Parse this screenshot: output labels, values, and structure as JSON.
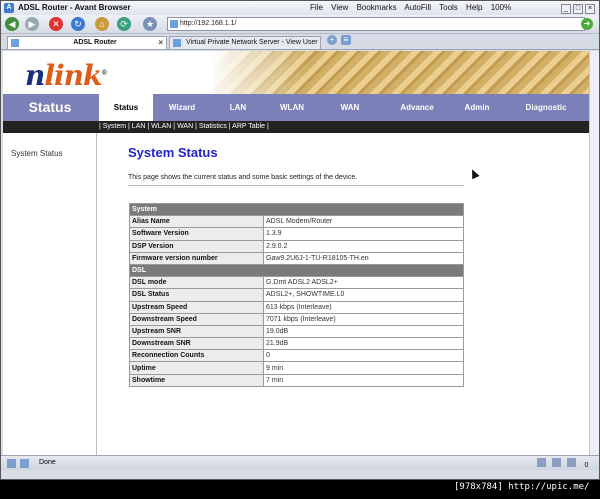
{
  "window": {
    "title": "ADSL Router - Avant Browser",
    "menu": [
      "File",
      "View",
      "Bookmarks",
      "AutoFill",
      "Tools",
      "Help",
      "100%"
    ]
  },
  "address": {
    "url": "http://192.168.1.1/"
  },
  "tabs": [
    {
      "label": "ADSL Router"
    },
    {
      "label": "Virtual Private Network Server - View User"
    }
  ],
  "router": {
    "logo_text_a": "n",
    "logo_text_b": "link",
    "section_label": "Status",
    "nav": [
      "Status",
      "Wizard",
      "LAN",
      "WLAN",
      "WAN",
      "Advance",
      "Admin",
      "Diagnostic"
    ],
    "subnav": "| System | LAN | WLAN | WAN | Statistics | ARP Table |",
    "side_item": "System Status"
  },
  "main": {
    "heading": "System Status",
    "description": "This page shows the current status and some basic settings of the device.",
    "system_header": "System",
    "system_rows": [
      {
        "key": "Alias Name",
        "value": "ADSL Modem/Router"
      },
      {
        "key": "Software Version",
        "value": "1.3.9"
      },
      {
        "key": "DSP Version",
        "value": "2.9.0.2"
      },
      {
        "key": "Firmware version number",
        "value": "Gaw9.2U6J-1-TU-R18105-TH.en"
      }
    ],
    "dsl_header": "DSL",
    "dsl_rows": [
      {
        "key": "DSL mode",
        "value": "G.Dmt ADSL2 ADSL2+"
      },
      {
        "key": "DSL Status",
        "value": "ADSL2+, SHOWTIME.L0"
      },
      {
        "key": "Upstream Speed",
        "value": "613 kbps  (Interleave)"
      },
      {
        "key": "Downstream Speed",
        "value": "7071 kbps  (Interleave)"
      },
      {
        "key": "Upstream SNR",
        "value": "19.0dB"
      },
      {
        "key": "Downstream SNR",
        "value": "21.9dB"
      },
      {
        "key": "Reconnection Counts",
        "value": "0"
      },
      {
        "key": "Uptime",
        "value": "9 min"
      },
      {
        "key": "Showtime",
        "value": "7 min"
      }
    ]
  },
  "statusbar": {
    "text": "Done",
    "count": "0"
  },
  "watermark": "[978x784] http://upic.me/"
}
